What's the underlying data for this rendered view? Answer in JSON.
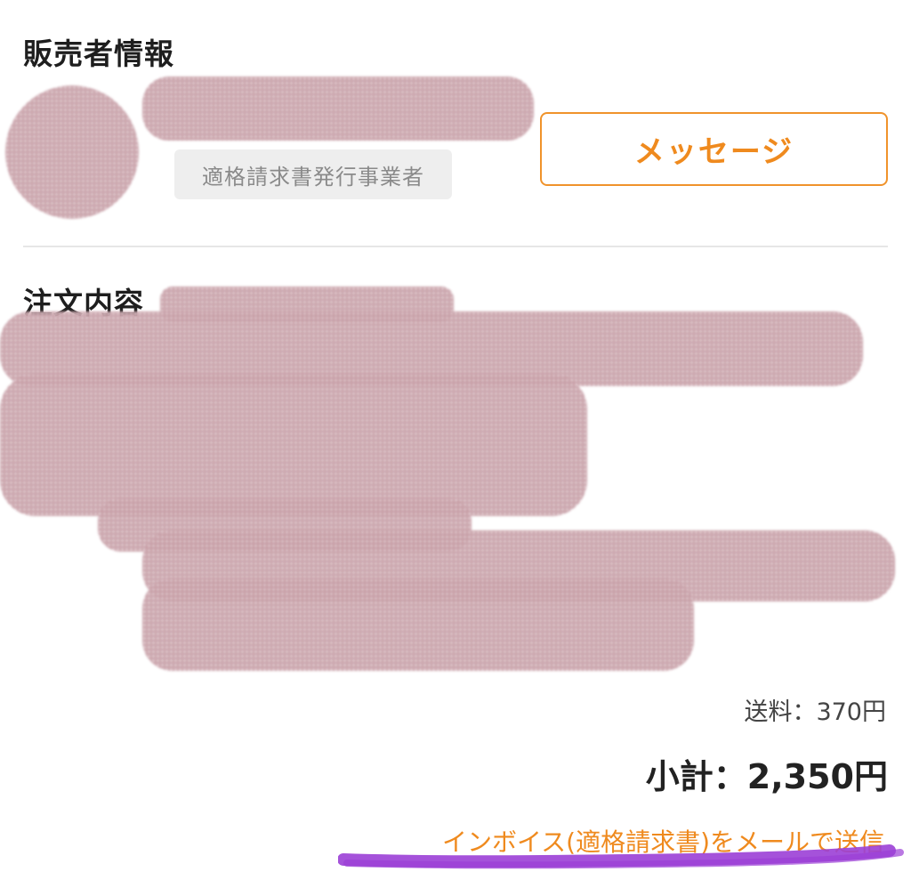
{
  "seller": {
    "title": "販売者情報",
    "badge": "適格請求書発行事業者",
    "message_button": "メッセージ"
  },
  "order": {
    "title": "注文内容",
    "shipping": "送料：370円",
    "subtotal": "小計：2,350円",
    "invoice_link": "インボイス(適格請求書)をメールで送信"
  },
  "colors": {
    "accent": "#ef8a1e",
    "highlight": "#9b3fd6",
    "redaction": "#c79ea6"
  }
}
